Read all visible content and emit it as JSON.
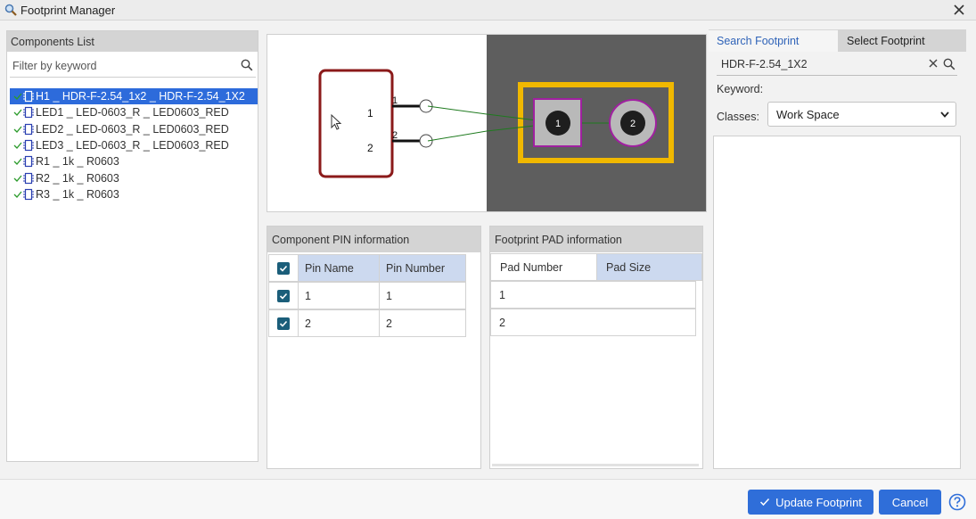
{
  "window": {
    "title": "Footprint Manager",
    "app_icon": "magnifier-icon",
    "close_icon": "close-icon"
  },
  "components": {
    "header": "Components List",
    "filter_placeholder": "Filter by keyword",
    "items": [
      {
        "label": "H1 _ HDR-F-2.54_1x2 _ HDR-F-2.54_1X2",
        "selected": true
      },
      {
        "label": "LED1 _ LED-0603_R _ LED0603_RED",
        "selected": false
      },
      {
        "label": "LED2 _ LED-0603_R _ LED0603_RED",
        "selected": false
      },
      {
        "label": "LED3 _ LED-0603_R _ LED0603_RED",
        "selected": false
      },
      {
        "label": "R1 _ 1k _ R0603",
        "selected": false
      },
      {
        "label": "R2 _ 1k _ R0603",
        "selected": false
      },
      {
        "label": "R3 _ 1k _ R0603",
        "selected": false
      }
    ]
  },
  "preview": {
    "symbol_pins": [
      "1",
      "2"
    ],
    "symbol_pin_numbers": [
      "1",
      "2"
    ],
    "pads": [
      "1",
      "2"
    ],
    "colors": {
      "symbol_body": "#8b1a1a",
      "footprint_bg": "#5e5e5e",
      "silkscreen": "#f0b800",
      "pad_outline": "#a020a0",
      "ratsnest": "#1e7a1e"
    }
  },
  "pin_table": {
    "header": "Component PIN information",
    "columns": [
      "Pin Name",
      "Pin Number"
    ],
    "rows": [
      {
        "name": "1",
        "number": "1",
        "checked": true
      },
      {
        "name": "2",
        "number": "2",
        "checked": true
      }
    ]
  },
  "pad_table": {
    "header": "Footprint PAD information",
    "columns": [
      "Pad Number",
      "Pad Size"
    ],
    "rows": [
      {
        "number": "1",
        "size": ""
      },
      {
        "number": "2",
        "size": ""
      }
    ]
  },
  "right": {
    "tabs": [
      "Search Footprint",
      "Select Footprint"
    ],
    "active_tab": "Search Footprint",
    "search_value": "HDR-F-2.54_1X2",
    "keyword_label": "Keyword:",
    "classes_label": "Classes:",
    "classes_value": "Work Space"
  },
  "footer": {
    "update_label": "Update Footprint",
    "cancel_label": "Cancel"
  },
  "accent": "#2f6ed9"
}
